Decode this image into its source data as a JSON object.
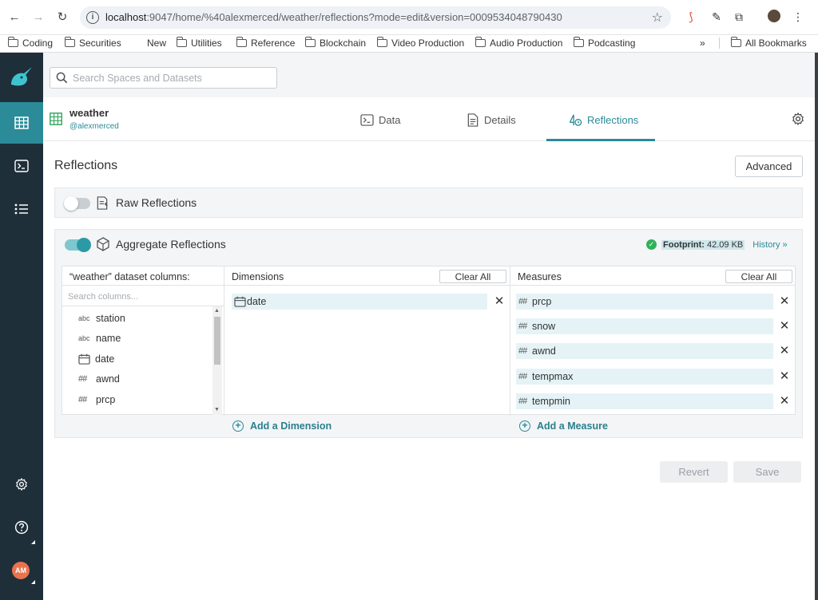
{
  "browser": {
    "url_host": "localhost",
    "url_rest": ":9047/home/%40alexmerced/weather/reflections?mode=edit&version=0009534048790430",
    "bookmarks": [
      "Coding",
      "Securities",
      "New",
      "Utilities",
      "Reference",
      "Blockchain",
      "Video Production",
      "Audio Production",
      "Podcasting"
    ],
    "more_bookmarks": "»",
    "all_bookmarks": "All Bookmarks"
  },
  "search": {
    "placeholder": "Search Spaces and Datasets"
  },
  "dataset": {
    "name": "weather",
    "owner": "@alexmerced"
  },
  "tabs": [
    {
      "label": "Data",
      "icon": "terminal-icon"
    },
    {
      "label": "Details",
      "icon": "details-doc-icon"
    },
    {
      "label": "Reflections",
      "icon": "reflections-icon"
    }
  ],
  "active_tab": "Reflections",
  "page": {
    "title": "Reflections",
    "advanced_label": "Advanced"
  },
  "raw": {
    "label": "Raw Reflections",
    "enabled": false
  },
  "aggregate": {
    "label": "Aggregate Reflections",
    "enabled": true,
    "footprint_label": "Footprint:",
    "footprint_value": "42.09 KB",
    "history_label": "History »"
  },
  "columns_panel": {
    "header": "“weather” dataset columns:",
    "search_placeholder": "Search columns...",
    "items": [
      {
        "type": "abc",
        "name": "station"
      },
      {
        "type": "abc",
        "name": "name"
      },
      {
        "type": "date",
        "name": "date"
      },
      {
        "type": "##",
        "name": "awnd"
      },
      {
        "type": "##",
        "name": "prcp"
      }
    ]
  },
  "dimensions": {
    "header": "Dimensions",
    "clear_label": "Clear All",
    "items": [
      {
        "type": "date",
        "name": "date"
      }
    ],
    "add_label": "Add a Dimension"
  },
  "measures": {
    "header": "Measures",
    "clear_label": "Clear All",
    "items": [
      {
        "type": "##",
        "name": "prcp"
      },
      {
        "type": "##",
        "name": "snow"
      },
      {
        "type": "##",
        "name": "awnd"
      },
      {
        "type": "##",
        "name": "tempmax"
      },
      {
        "type": "##",
        "name": "tempmin"
      }
    ],
    "add_label": "Add a Measure"
  },
  "footer": {
    "revert_label": "Revert",
    "save_label": "Save"
  },
  "user": {
    "initials": "AM"
  },
  "colors": {
    "accent": "#2b8b98",
    "sidebar": "#1f2f3a",
    "chip": "#e5f3f7"
  }
}
